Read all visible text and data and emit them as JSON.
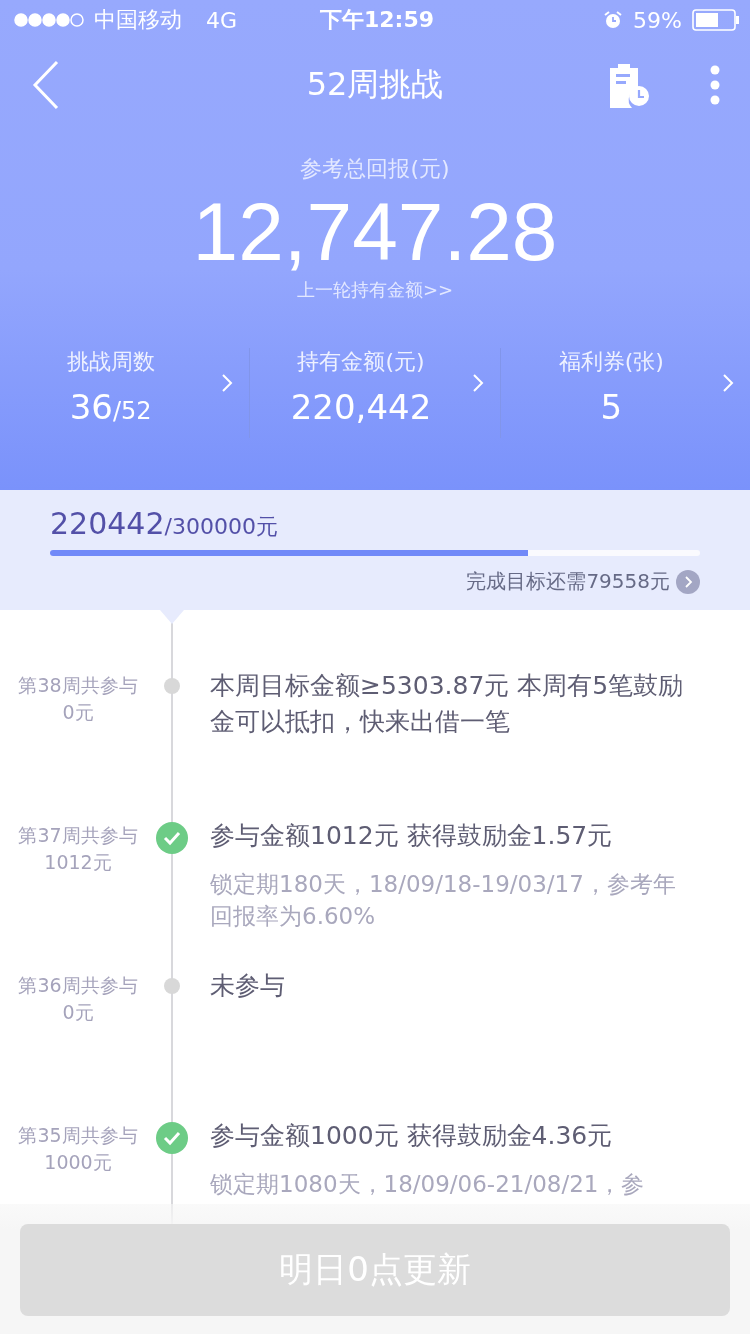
{
  "status_bar": {
    "carrier": "中国移动",
    "network": "4G",
    "time": "下午12:59",
    "battery": "59%"
  },
  "nav": {
    "title": "52周挑战"
  },
  "summary": {
    "label": "参考总回报(元)",
    "value": "12,747.28",
    "link": "上一轮持有金额>>"
  },
  "stats": [
    {
      "label": "挑战周数",
      "value": "36",
      "suffix": "/52"
    },
    {
      "label": "持有金额(元)",
      "value": "220,442"
    },
    {
      "label": "福利券(张)",
      "value": "5"
    }
  ],
  "goal": {
    "current": "220442",
    "target": "/300000元",
    "level": 0.735,
    "remaining": "完成目标还需79558元"
  },
  "timeline": [
    {
      "week": "第38周共参与",
      "amount": "0元",
      "done": false,
      "title": "本周目标金额≥5303.87元 本周有5笔鼓励金可以抵扣，快来出借一笔"
    },
    {
      "week": "第37周共参与",
      "amount": "1012元",
      "done": true,
      "title": "参与金额1012元 获得鼓励金1.57元",
      "detail": "锁定期180天，18/09/18-19/03/17，参考年回报率为6.60%"
    },
    {
      "week": "第36周共参与",
      "amount": "0元",
      "done": false,
      "title": "未参与"
    },
    {
      "week": "第35周共参与",
      "amount": "1000元",
      "done": true,
      "title": "参与金额1000元 获得鼓励金4.36元",
      "detail": "锁定期1080天，18/09/06-21/08/21，参"
    }
  ],
  "footer_button": {
    "label": "明日0点更新",
    "disabled": true
  }
}
